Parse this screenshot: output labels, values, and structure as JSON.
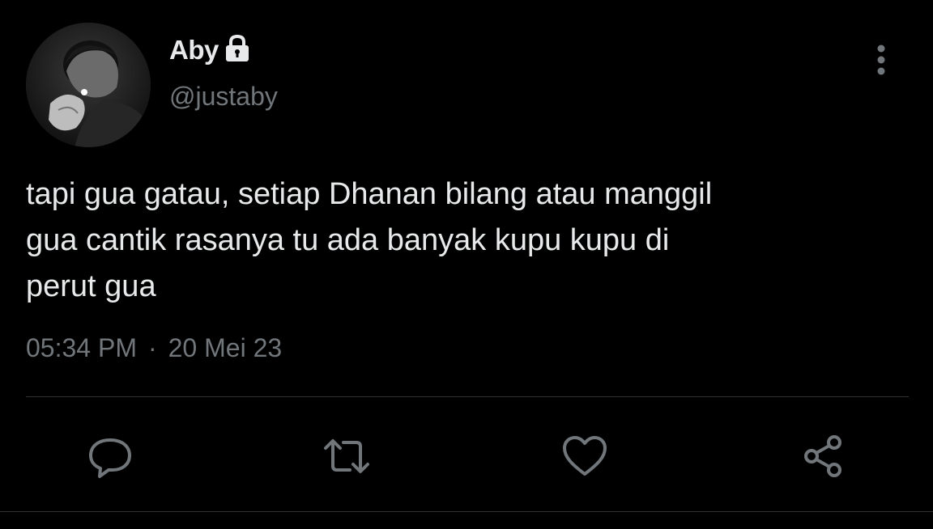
{
  "author": {
    "display_name": "Aby",
    "handle": "@justaby",
    "protected_icon": "lock-icon",
    "avatar": "profile-photo"
  },
  "menu": {
    "icon": "more-vertical-icon"
  },
  "tweet": {
    "text": "tapi gua gatau, setiap Dhanan bilang atau manggil\ngua cantik rasanya tu ada banyak kupu kupu di\nperut gua",
    "time": "05:34 PM",
    "separator": "·",
    "date": "20 Mei 23"
  },
  "actions": [
    {
      "name": "reply",
      "icon": "reply-icon"
    },
    {
      "name": "retweet",
      "icon": "retweet-icon"
    },
    {
      "name": "like",
      "icon": "heart-icon"
    },
    {
      "name": "share",
      "icon": "share-icon"
    }
  ],
  "colors": {
    "background": "#000000",
    "text_primary": "#e7e9ea",
    "text_secondary": "#71767b",
    "divider": "#2f3336"
  }
}
